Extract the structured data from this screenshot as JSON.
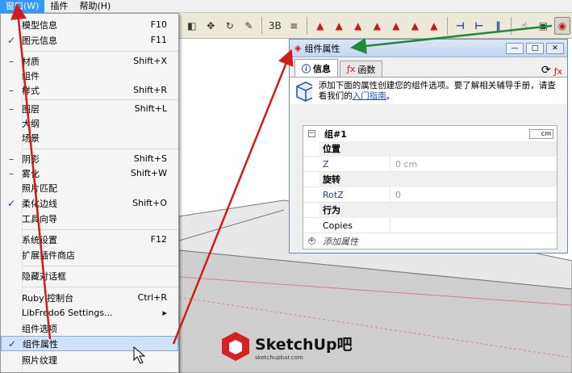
{
  "menubar": {
    "items": [
      "窗口(W)",
      "插件",
      "帮助(H)"
    ]
  },
  "menu": {
    "items": [
      {
        "label": "模型信息",
        "shortcut": "F10",
        "check": ""
      },
      {
        "label": "图元信息",
        "shortcut": "F11",
        "check": "✓"
      },
      {
        "label": "材质",
        "shortcut": "Shift+X",
        "check": "–"
      },
      {
        "label": "组件",
        "shortcut": "",
        "check": ""
      },
      {
        "label": "样式",
        "shortcut": "Shift+R",
        "check": "–"
      },
      {
        "label": "图层",
        "shortcut": "Shift+L",
        "check": "–"
      },
      {
        "label": "大纲",
        "shortcut": "",
        "check": ""
      },
      {
        "label": "场景",
        "shortcut": "",
        "check": ""
      },
      {
        "label": "阴影",
        "shortcut": "Shift+S",
        "check": "–"
      },
      {
        "label": "雾化",
        "shortcut": "Shift+W",
        "check": "–"
      },
      {
        "label": "照片匹配",
        "shortcut": "",
        "check": ""
      },
      {
        "label": "柔化边线",
        "shortcut": "Shift+O",
        "check": "✓"
      },
      {
        "label": "工具向导",
        "shortcut": "",
        "check": ""
      },
      {
        "label": "系统设置",
        "shortcut": "F12",
        "check": ""
      },
      {
        "label": "扩展插件商店",
        "shortcut": "",
        "check": ""
      },
      {
        "label": "隐藏对话框",
        "shortcut": "",
        "check": ""
      },
      {
        "label": "Ruby 控制台",
        "shortcut": "Ctrl+R",
        "check": ""
      },
      {
        "label": "LibFredo6 Settings...",
        "shortcut": "▸",
        "check": ""
      },
      {
        "label": "组件选项",
        "shortcut": "",
        "check": ""
      },
      {
        "label": "组件属性",
        "shortcut": "",
        "check": "✓"
      },
      {
        "label": "照片纹理",
        "shortcut": "",
        "check": ""
      }
    ]
  },
  "panel": {
    "title": "组件属性",
    "tabs": [
      "信息",
      "函数"
    ],
    "info_text": "添加下面的属性创建您的组件选项。要了解相关辅导手册，请查看我们的",
    "info_link": "入门指南",
    "info_end": "。",
    "entity_name": "组#1",
    "unit": "cm",
    "rows": [
      {
        "type": "category",
        "name": "位置"
      },
      {
        "type": "prop",
        "name": "Z",
        "value": "0 cm"
      },
      {
        "type": "category",
        "name": "旋转"
      },
      {
        "type": "prop",
        "name": "RotZ",
        "value": "0"
      },
      {
        "type": "category",
        "name": "行为"
      },
      {
        "type": "plain",
        "name": "Copies",
        "value": ""
      }
    ],
    "add_attr": "添加属性"
  },
  "logo": {
    "title": "SketchUp吧",
    "sub": "sketchupbar.com"
  },
  "colors": {
    "arrow": "#d21c1c",
    "green_arrow": "#1e8a3a",
    "selection": "#cfe3f8"
  }
}
